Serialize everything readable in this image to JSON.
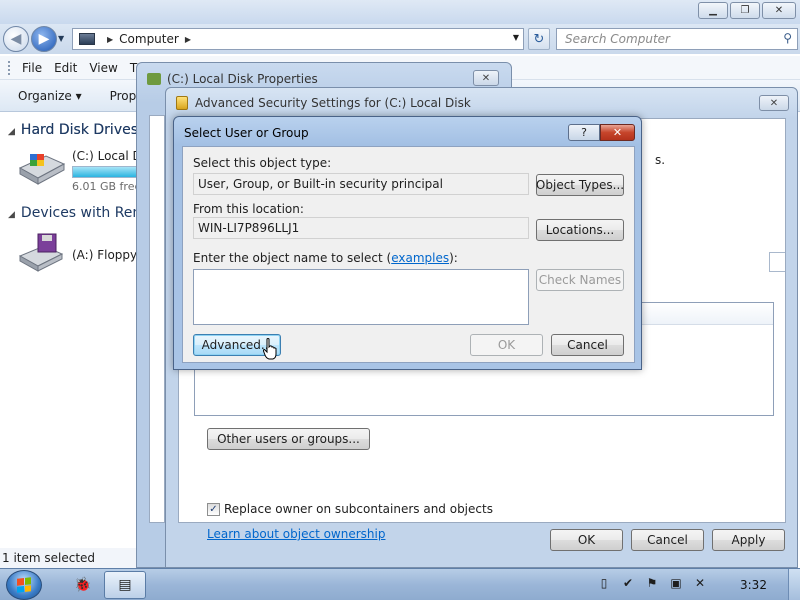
{
  "explorer": {
    "address_crumb": "Computer",
    "search_placeholder": "Search Computer",
    "menu": [
      "File",
      "Edit",
      "View",
      "T"
    ],
    "commands": [
      "Organize ▾",
      "Prope"
    ],
    "nav": {
      "hard_disk_header": "Hard Disk Drives",
      "local_disk_label": "(C:) Local Di",
      "local_disk_free": "6.01 GB free",
      "removable_header": "Devices with Rem",
      "floppy_label": "(A:) Floppy D"
    },
    "status": "1 item selected"
  },
  "properties_dialog": {
    "title": "(C:) Local Disk Properties"
  },
  "advanced_dialog": {
    "title": "Advanced Security Settings for (C:) Local Disk",
    "partial_text": "s.",
    "other_users_button": "Other users or groups...",
    "replace_owner_label": "Replace owner on subcontainers and objects",
    "replace_owner_checked": true,
    "learn_link": "Learn about object ownership",
    "ok": "OK",
    "cancel": "Cancel",
    "apply": "Apply"
  },
  "select_dialog": {
    "title": "Select User or Group",
    "help": "?",
    "object_type_label": "Select this object type:",
    "object_type_value": "User, Group, or Built-in security principal",
    "object_types_button": "Object Types...",
    "location_label": "From this location:",
    "location_value": "WIN-LI7P896LLJ1",
    "locations_button": "Locations...",
    "enter_name_label": "Enter the object name to select (",
    "examples_link": "examples",
    "enter_name_suffix": "):",
    "object_name_value": "",
    "check_names_button": "Check Names",
    "advanced_button": "Advanced...",
    "ok": "OK",
    "cancel": "Cancel"
  },
  "taskbar": {
    "clock": "3:32"
  },
  "colors": {
    "accent": "#3c7fb1",
    "link": "#0066cc",
    "close_red": "#c6452b"
  }
}
